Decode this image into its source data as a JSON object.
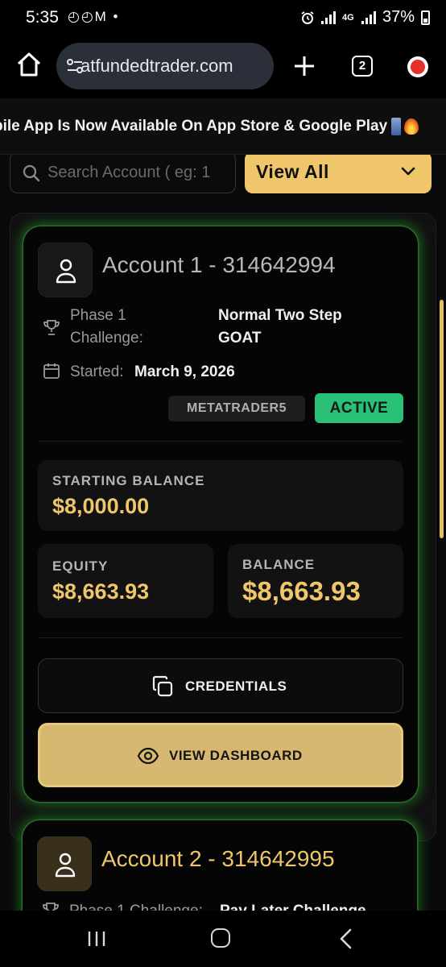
{
  "status_bar": {
    "time": "5:35",
    "left_icons": "◴◴M •",
    "network": "4G",
    "battery": "37%"
  },
  "browser": {
    "url": "atfundedtrader.com",
    "tab_count": "2"
  },
  "banner": {
    "text": "bile App Is Now Available On App Store & Google Play"
  },
  "search": {
    "placeholder": "Search Account ( eg: 1"
  },
  "filter": {
    "label": "View All"
  },
  "accounts": [
    {
      "title": "Account 1 - 314642994",
      "phase_label_1": "Phase 1",
      "phase_label_2": "Challenge:",
      "challenge_1": "Normal Two Step",
      "challenge_2": "GOAT",
      "started_label": "Started:",
      "started_date": "March 9, 2026",
      "platform": "METATRADER5",
      "status": "ACTIVE",
      "starting_balance_label": "STARTING BALANCE",
      "starting_balance": "$8,000.00",
      "equity_label": "EQUITY",
      "equity": "$8,663.93",
      "balance_label": "BALANCE",
      "balance": "$8,663.93",
      "credentials_label": "CREDENTIALS",
      "dashboard_label": "VIEW DASHBOARD"
    },
    {
      "title": "Account 2 - 314642995",
      "phase_label": "Phase 1 Challenge:",
      "challenge": "Pay Later Challenge"
    }
  ],
  "colors": {
    "accent_gold": "#efc66a",
    "active_green": "#2bc078",
    "glow_green": "#22a028"
  }
}
